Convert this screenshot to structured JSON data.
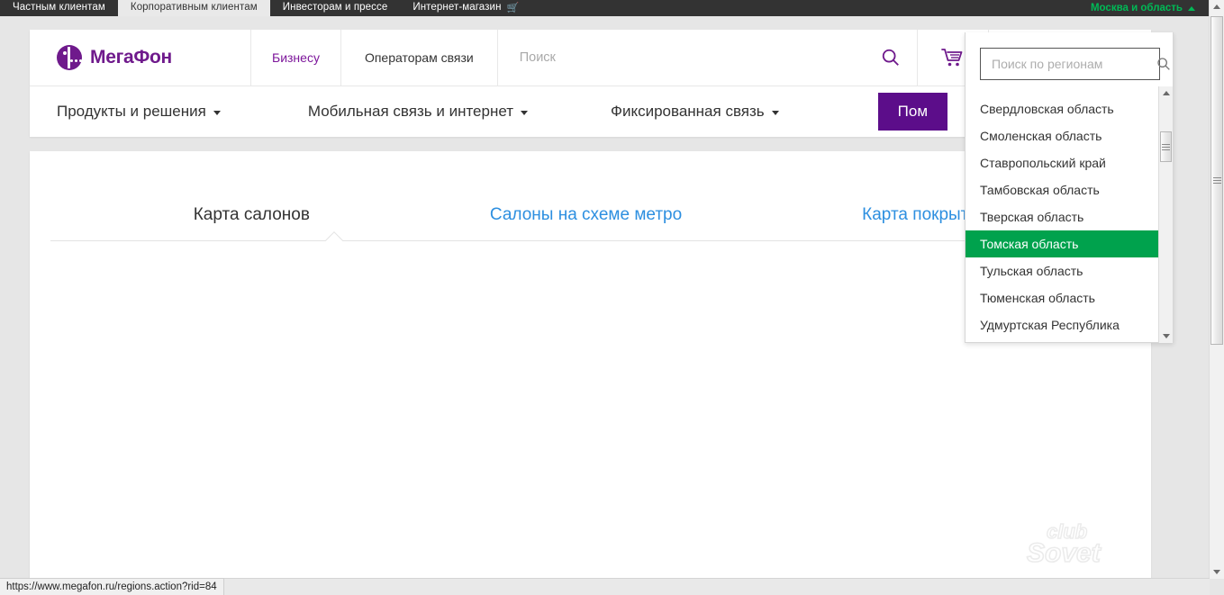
{
  "topbar": {
    "tabs": [
      {
        "label": "Частным клиентам",
        "active": false,
        "icon": ""
      },
      {
        "label": "Корпоративным клиентам",
        "active": true,
        "icon": ""
      },
      {
        "label": "Инвесторам и прессе",
        "active": false,
        "icon": ""
      },
      {
        "label": "Интернет-магазин",
        "active": false,
        "icon": "cart-icon"
      }
    ],
    "region_selector": {
      "label": "Москва и область",
      "icon": "caret-up-icon",
      "color": "#00b956"
    }
  },
  "header": {
    "logo": {
      "text": "МегаФон",
      "icon": "megafon-logo-icon",
      "color": "#6f1a8c"
    },
    "links": [
      {
        "label": "Бизнесу",
        "active": true
      },
      {
        "label": "Операторам связи",
        "active": false
      }
    ],
    "search": {
      "placeholder": "Поиск",
      "value": "",
      "icon": "search-icon"
    },
    "cart": {
      "icon": "cart-icon"
    },
    "nav": [
      {
        "label": "Продукты и решения",
        "caret": true
      },
      {
        "label": "Мобильная связь и интернет",
        "caret": true
      },
      {
        "label": "Фиксированная связь",
        "caret": true
      }
    ],
    "help_button": {
      "label": "Пом",
      "full_label": "Пом",
      "color": "#5c0d8a"
    }
  },
  "content": {
    "tabs": [
      {
        "label": "Карта салонов",
        "active": true
      },
      {
        "label": "Салоны на схеме метро",
        "active": false
      },
      {
        "label": "Карта покрытия",
        "active": false
      }
    ],
    "watermark": {
      "line1": "club",
      "line2": "Sovet"
    }
  },
  "region_dropdown": {
    "search": {
      "placeholder": "Поиск по регионам",
      "value": "",
      "icon": "search-icon"
    },
    "items": [
      {
        "label": "Свердловская область",
        "selected": false
      },
      {
        "label": "Смоленская область",
        "selected": false
      },
      {
        "label": "Ставропольский край",
        "selected": false
      },
      {
        "label": "Тамбовская область",
        "selected": false
      },
      {
        "label": "Тверская область",
        "selected": false
      },
      {
        "label": "Томская область",
        "selected": true
      },
      {
        "label": "Тульская область",
        "selected": false
      },
      {
        "label": "Тюменская область",
        "selected": false
      },
      {
        "label": "Удмуртская Республика",
        "selected": false
      }
    ],
    "highlight_color": "#00a24d"
  },
  "statusbar": {
    "url": "https://www.megafon.ru/regions.action?rid=84"
  }
}
